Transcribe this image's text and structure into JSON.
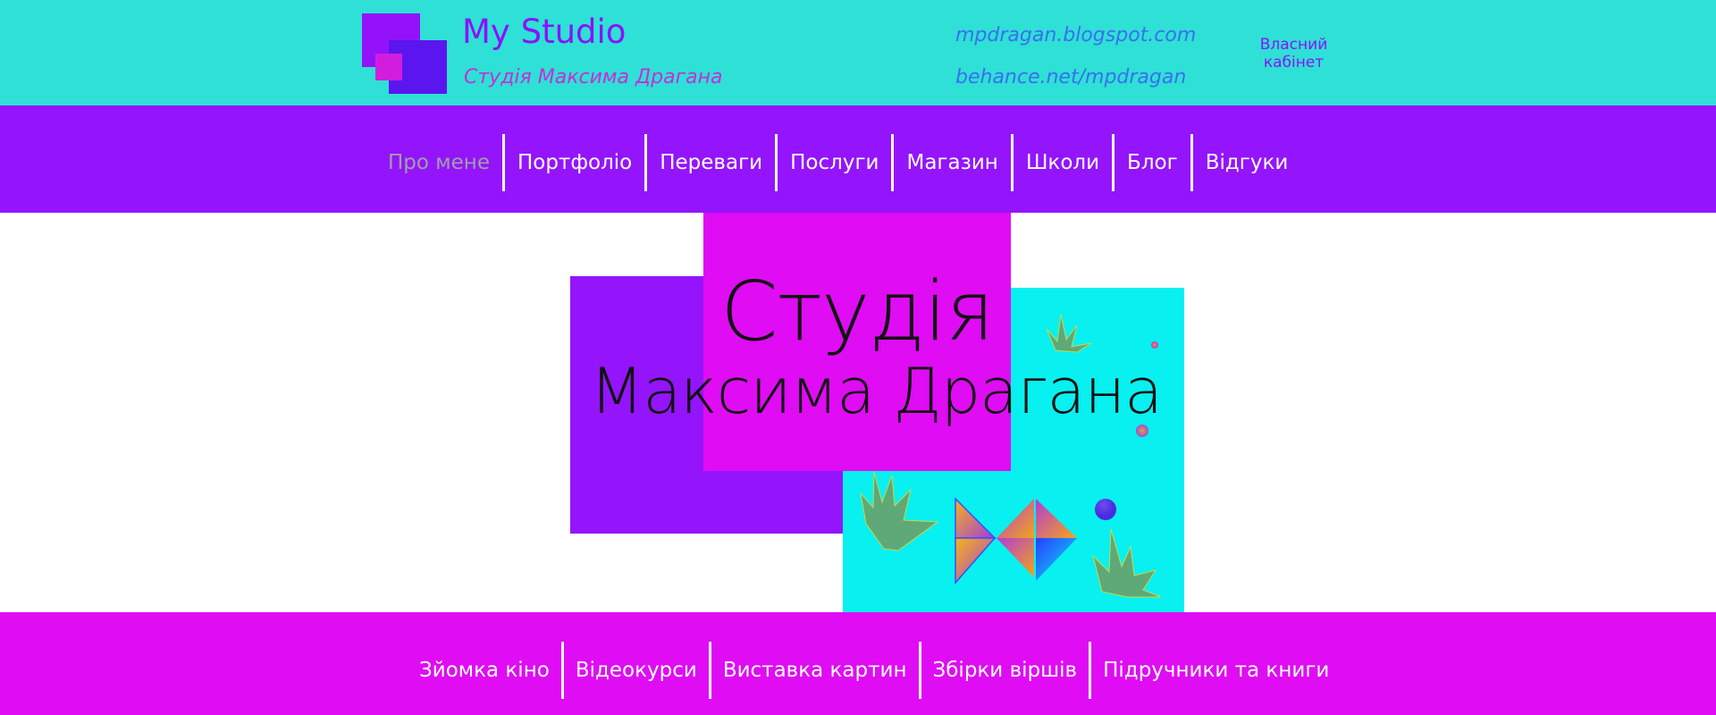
{
  "header": {
    "title": "My Studio",
    "subtitle": "Студія Максима Драгана",
    "link_blog": "mpdragan.blogspot.com",
    "link_behance": "behance.net/mpdragan",
    "cabinet_label": "Власний кабінет"
  },
  "nav": {
    "items": [
      {
        "label": "Про мене",
        "active": true
      },
      {
        "label": "Портфоліо"
      },
      {
        "label": "Переваги"
      },
      {
        "label": "Послуги"
      },
      {
        "label": "Магазин"
      },
      {
        "label": "Школи"
      },
      {
        "label": "Блог"
      },
      {
        "label": "Відгуки"
      }
    ]
  },
  "hero": {
    "line1": "Студія",
    "line2": "Максима Драгана"
  },
  "footer": {
    "items": [
      {
        "label": "Зйомка кіно"
      },
      {
        "label": "Відеокурси"
      },
      {
        "label": "Виставка картин"
      },
      {
        "label": "Збірки віршів"
      },
      {
        "label": "Підручники та книги"
      }
    ]
  },
  "colors": {
    "header_bg": "#2ee0d6",
    "nav_bg": "#9414fb",
    "footer_bg": "#df0cf4",
    "hero_violet": "#9414fb",
    "hero_magenta": "#df0cf4",
    "hero_cyan": "#08f0f0"
  },
  "icons": [
    "logo-squares-icon",
    "grass-tuft-icon",
    "triangle-flower-icon",
    "dot-icon"
  ]
}
